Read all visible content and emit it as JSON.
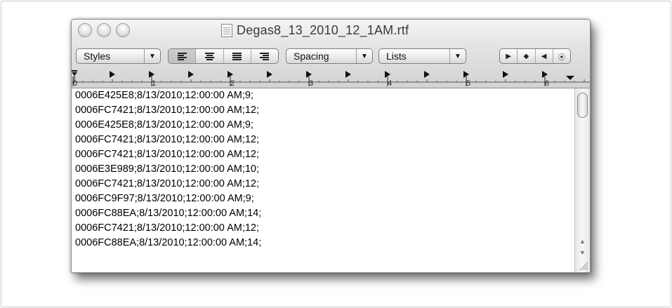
{
  "window": {
    "title": "Degas8_13_2010_12_1AM.rtf",
    "file_icon": "rtf-document-icon",
    "traffic_lights": [
      "close",
      "minimize",
      "zoom"
    ]
  },
  "toolbar": {
    "styles_label": "Styles",
    "spacing_label": "Spacing",
    "lists_label": "Lists",
    "alignment": [
      "align-left",
      "align-center",
      "justify",
      "align-right"
    ],
    "selected_alignment": "align-left",
    "nav_icons": [
      "play-right-icon",
      "diamond-icon",
      "play-left-icon",
      "circle-icon"
    ]
  },
  "ruler": {
    "labels": [
      "0",
      "1",
      "2",
      "3",
      "4",
      "5",
      "6"
    ]
  },
  "document": {
    "lines": [
      "0006E425E8;8/13/2010;12:00:00 AM;9;",
      "0006FC7421;8/13/2010;12:00:00 AM;12;",
      "0006E425E8;8/13/2010;12:00:00 AM;9;",
      "0006FC7421;8/13/2010;12:00:00 AM;12;",
      "0006FC7421;8/13/2010;12:00:00 AM;12;",
      "0006E3E989;8/13/2010;12:00:00 AM;10;",
      "0006FC7421;8/13/2010;12:00:00 AM;12;",
      "0006FC9F97;8/13/2010;12:00:00 AM;9;",
      "0006FC88EA;8/13/2010;12:00:00 AM;14;",
      "0006FC7421;8/13/2010;12:00:00 AM;12;",
      "0006FC88EA;8/13/2010;12:00:00 AM;14;"
    ]
  }
}
